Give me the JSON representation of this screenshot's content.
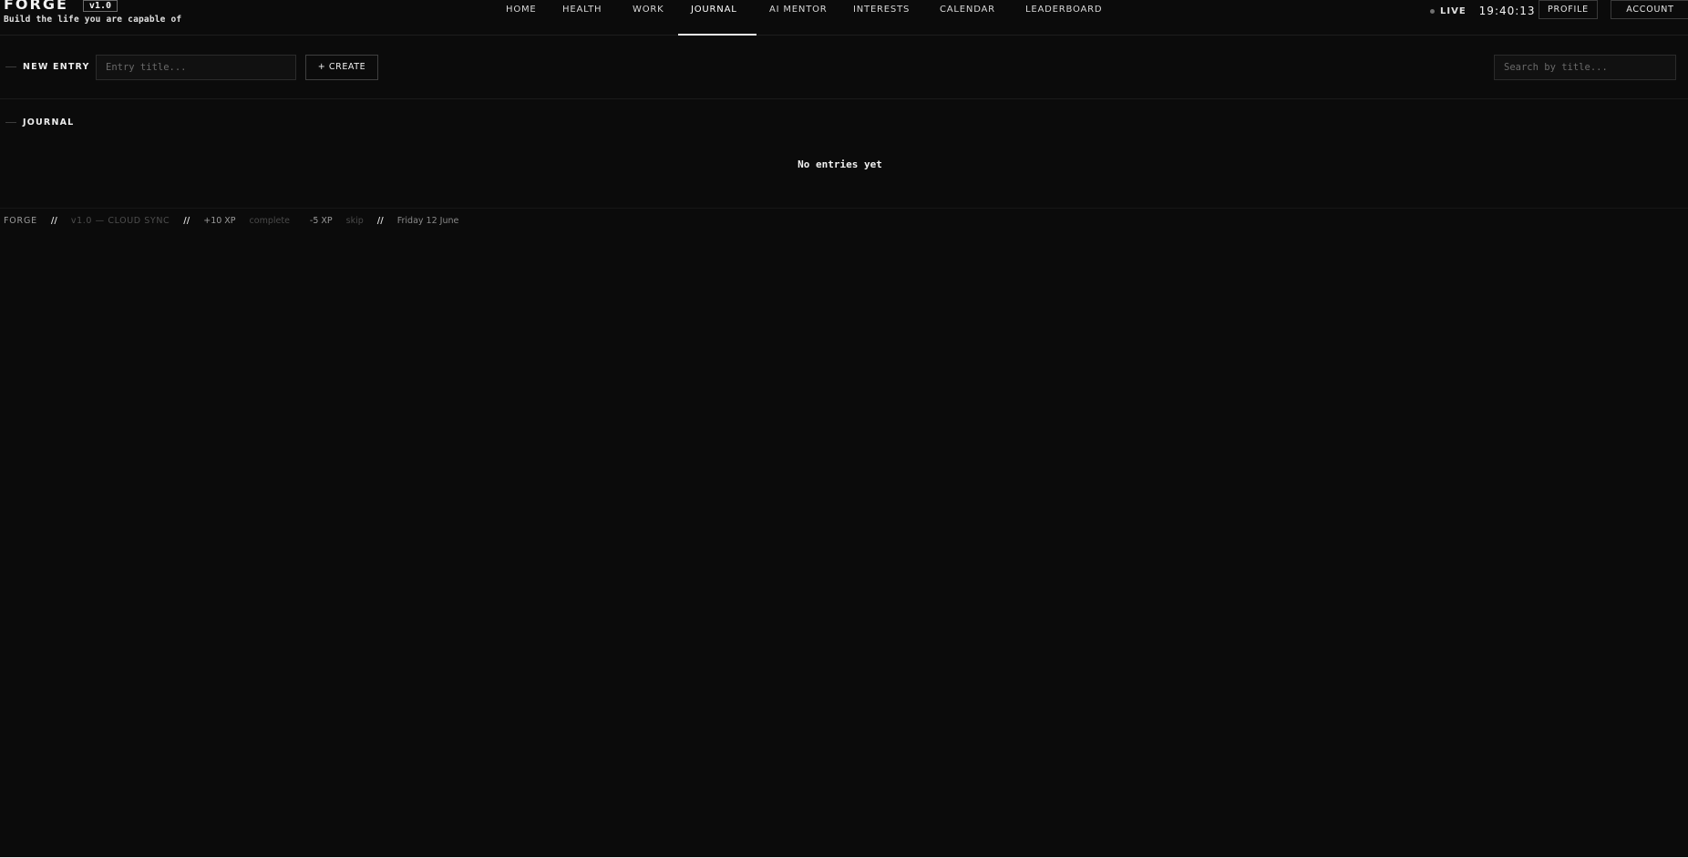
{
  "brand": {
    "name": "FORGE",
    "version": "v1.0",
    "tagline": "Build the life you are capable of"
  },
  "nav": {
    "items": [
      {
        "label": "HOME"
      },
      {
        "label": "HEALTH"
      },
      {
        "label": "WORK"
      },
      {
        "label": "JOURNAL",
        "active": true
      },
      {
        "label": "AI MENTOR"
      },
      {
        "label": "INTERESTS"
      },
      {
        "label": "CALENDAR"
      },
      {
        "label": "LEADERBOARD"
      }
    ]
  },
  "status": {
    "live_label": "LIVE",
    "time": "19:40:13"
  },
  "header_buttons": {
    "profile": "PROFILE",
    "account": "ACCOUNT"
  },
  "new_entry": {
    "label": "NEW ENTRY",
    "title_placeholder": "Entry title...",
    "create_label": "+ CREATE",
    "search_placeholder": "Search by title..."
  },
  "journal": {
    "label": "JOURNAL",
    "empty_message": "No entries yet"
  },
  "footer": {
    "brand": "FORGE",
    "separator": "//",
    "sync": "v1.0 — CLOUD SYNC",
    "xp_complete": "+10 XP",
    "complete_label": "complete",
    "xp_skip": "-5 XP",
    "skip_label": "skip",
    "date": "Friday 12 June"
  },
  "colors": {
    "background": "#0b0b0b",
    "text": "#e8e8e8",
    "border": "#2b2b2b",
    "live_dot": "#6f6f6f"
  }
}
